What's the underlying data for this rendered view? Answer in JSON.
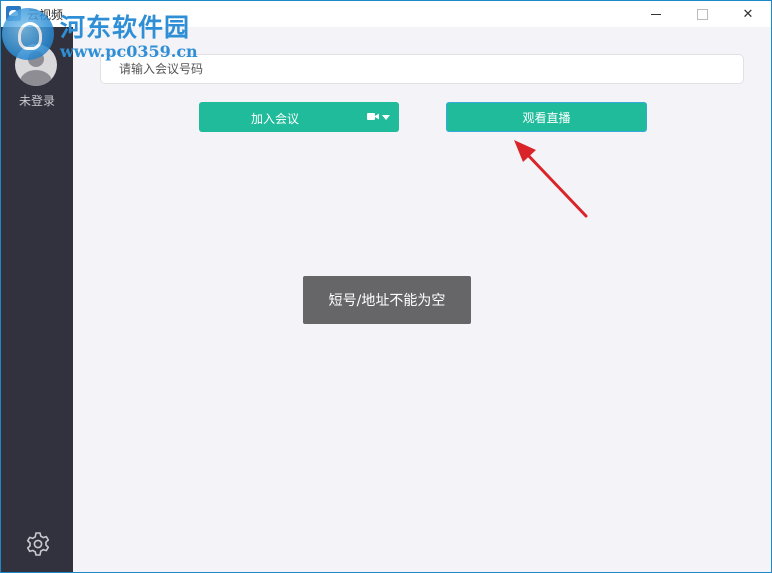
{
  "window": {
    "title": "云视频",
    "minimize_icon": "minimize-icon",
    "maximize_icon": "maximize-icon",
    "close_icon": "close-icon",
    "close_glyph": "✕"
  },
  "watermark": {
    "site_name": "河东软件园",
    "url": "www.pc0359.cn"
  },
  "sidebar": {
    "avatar_icon": "user-avatar-icon",
    "login_status": "未登录",
    "settings_icon": "gear-icon",
    "background_color": "#32323e"
  },
  "meeting": {
    "input_placeholder": "请输入会议号码",
    "input_value": "",
    "join_button": "加入会议",
    "join_camera_icon": "video-camera-icon",
    "join_dropdown_icon": "caret-down-icon",
    "watch_live_button": "观看直播"
  },
  "toast": {
    "message": "短号/地址不能为空"
  },
  "colors": {
    "accent": "#1fbb9a",
    "annotation_arrow": "#d9252a",
    "toast_background": "#666568"
  }
}
